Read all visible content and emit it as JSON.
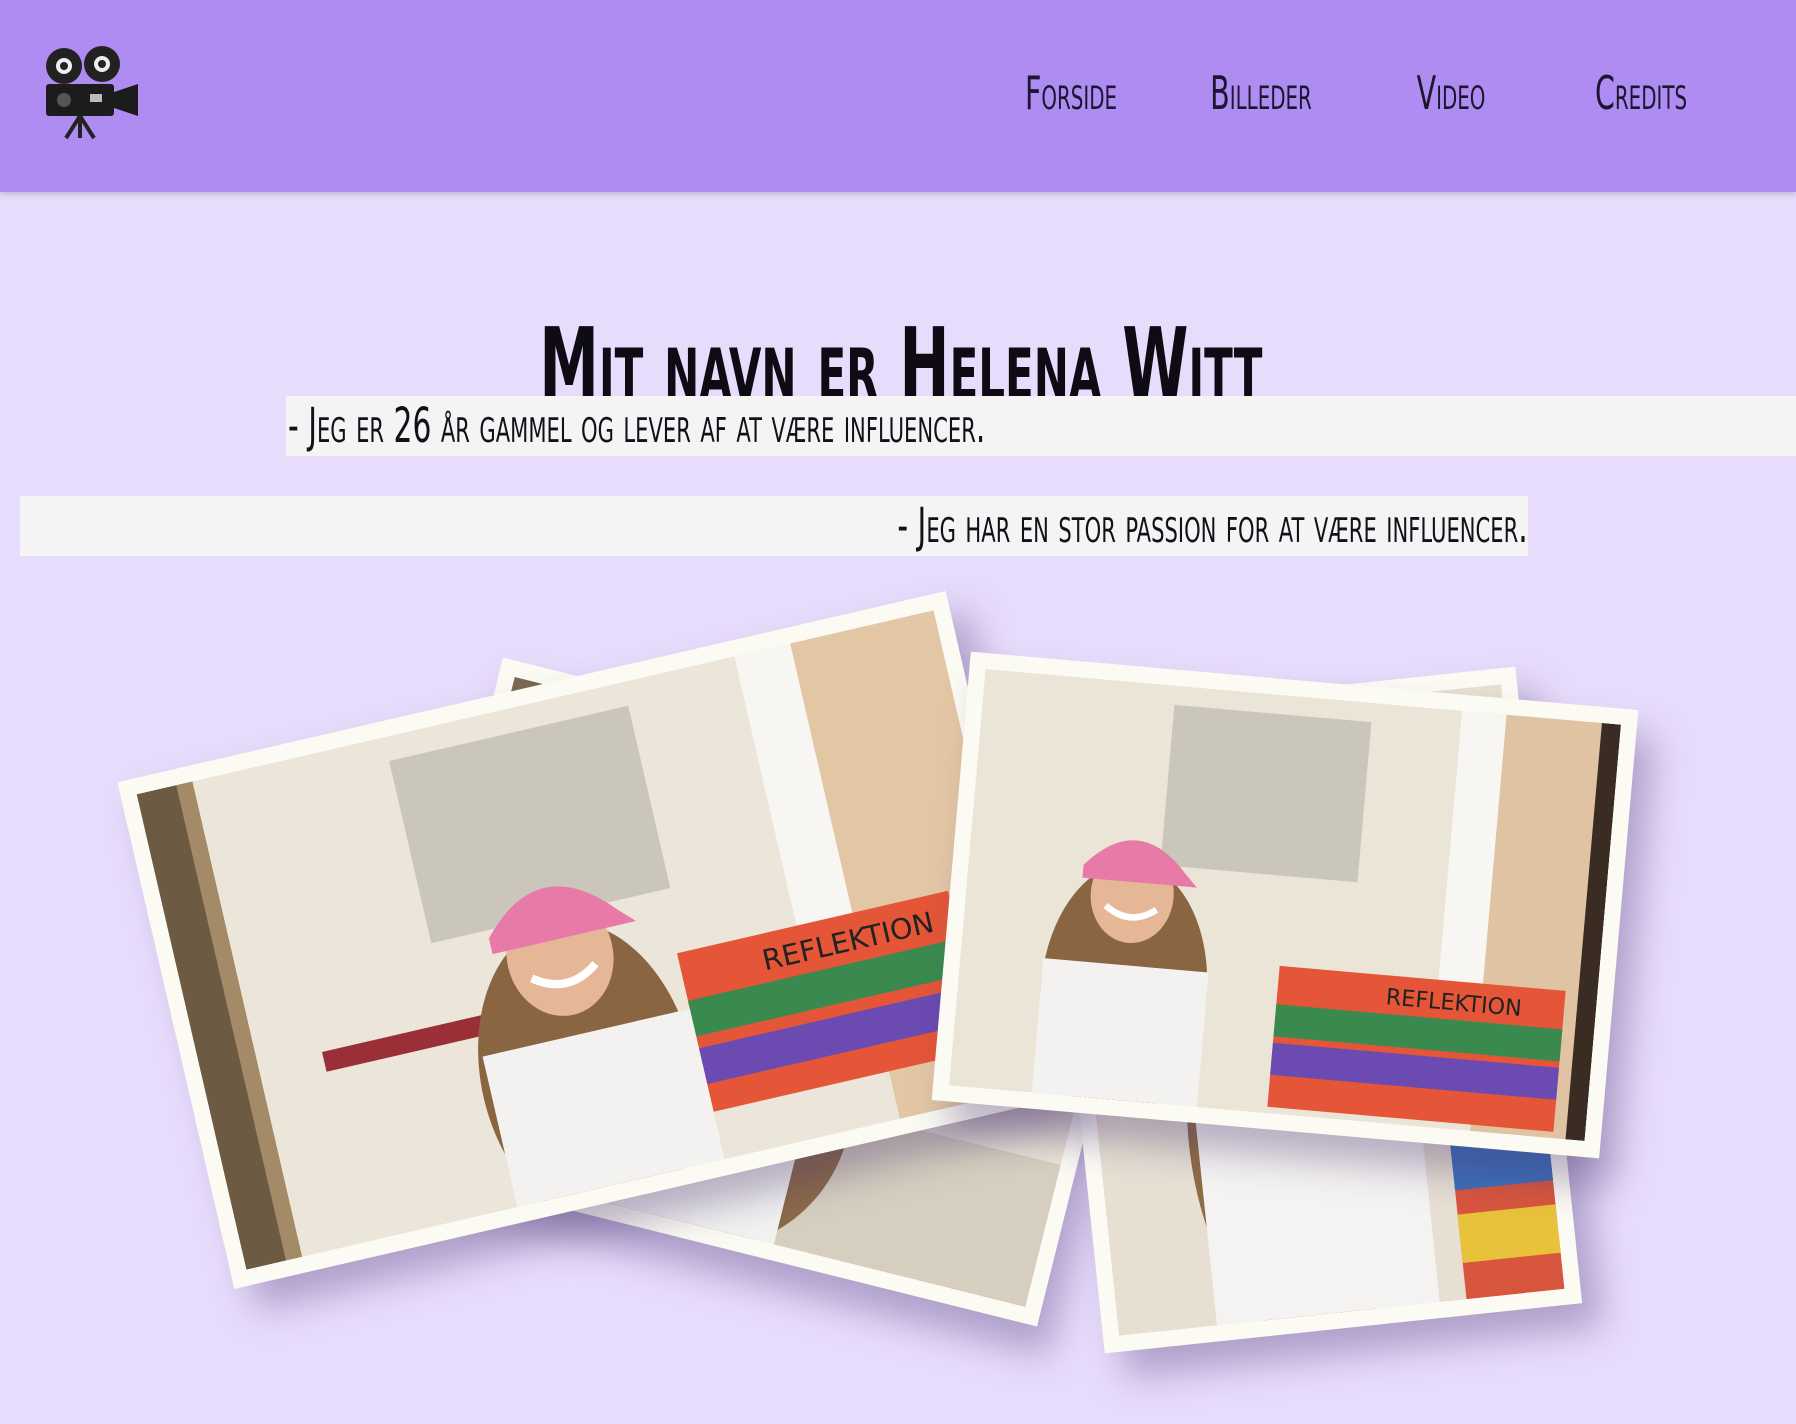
{
  "header": {
    "logo_icon": "film-camera-icon",
    "nav": [
      {
        "label": "Forside"
      },
      {
        "label": "Billeder"
      },
      {
        "label": "Video"
      },
      {
        "label": "Credits"
      }
    ]
  },
  "main": {
    "title": "Mit navn er Helena Witt",
    "line1": "- Jeg er 26 år gammel og lever af at være influencer.",
    "line2": "- Jeg har en stor passion for at være influencer."
  },
  "colors": {
    "header_bg": "#af8cf2",
    "page_bg": "#e8dcfc",
    "text_strip_bg": "#f5f4f5"
  }
}
